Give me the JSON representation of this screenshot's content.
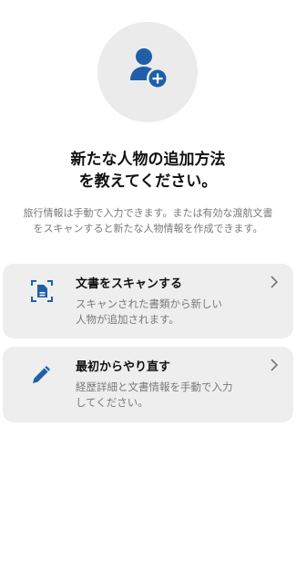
{
  "header": {
    "title_line1": "新たな人物の追加方法",
    "title_line2": "を教えてください。",
    "subtitle_line1": "旅行情報は手動で入力できます。または有効な渡航文書",
    "subtitle_line2": "をスキャンすると新たな人物情報を作成できます。"
  },
  "options": [
    {
      "title": "文書をスキャンする",
      "desc_line1": "スキャンされた書類から新しい",
      "desc_line2": "人物が追加されます。",
      "icon": "scan-document-icon"
    },
    {
      "title": "最初からやり直す",
      "desc_line1": "経歴詳細と文書情報を手動で入力",
      "desc_line2": "してください。",
      "icon": "pencil-icon"
    }
  ],
  "colors": {
    "accent": "#1f5fa8",
    "card_bg": "#eeeeee",
    "hero_bg": "#ebebeb",
    "muted_text": "#7a7a7a"
  },
  "hero_icon": "add-person-icon"
}
